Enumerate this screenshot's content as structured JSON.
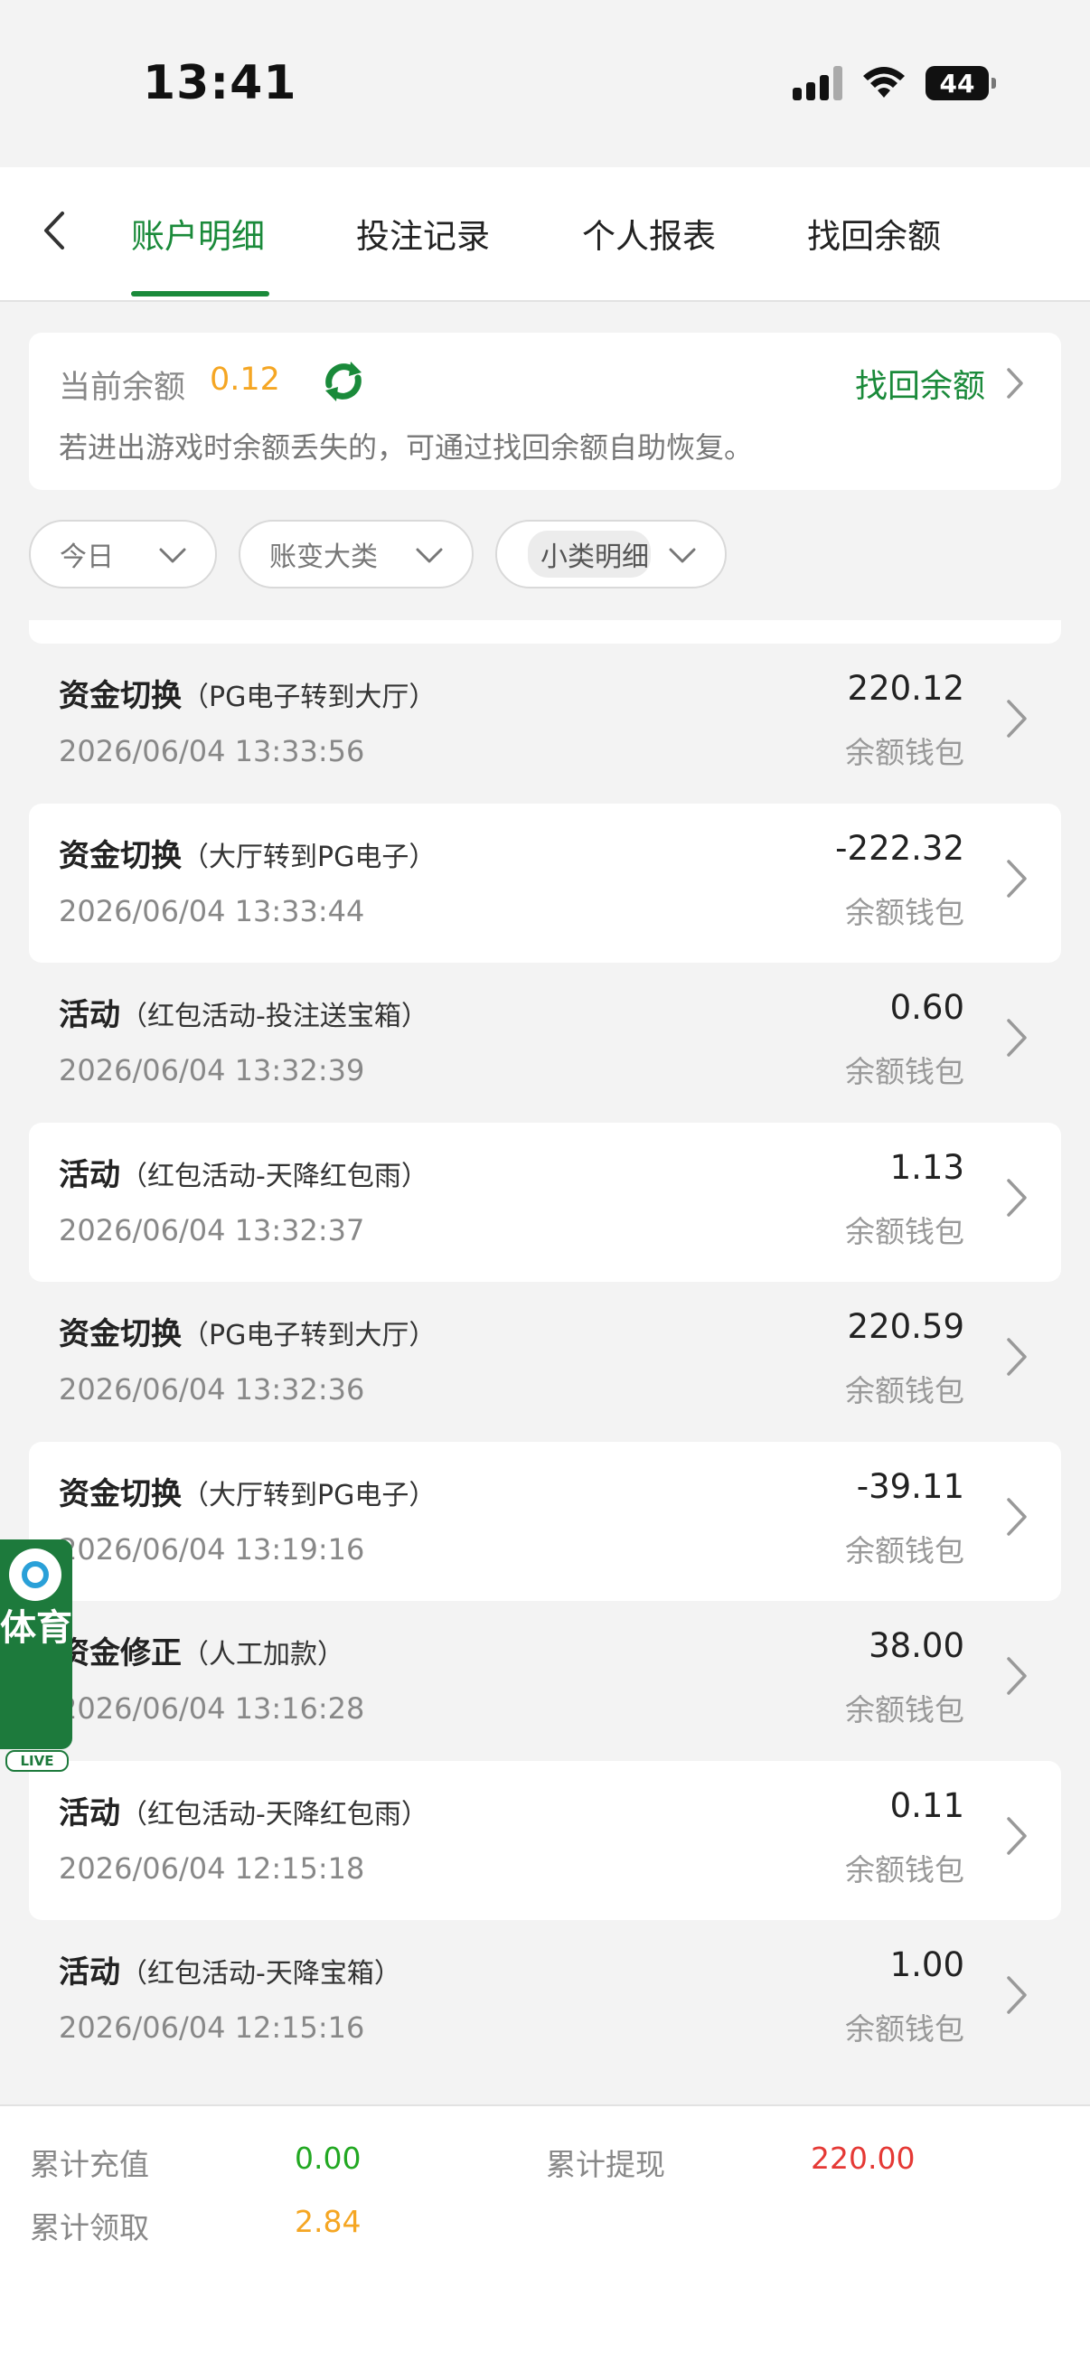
{
  "status_bar": {
    "time": "13:41",
    "battery": "44"
  },
  "tabs": [
    {
      "label": "账户明细",
      "active": true
    },
    {
      "label": "投注记录",
      "active": false
    },
    {
      "label": "个人报表",
      "active": false
    },
    {
      "label": "找回余额",
      "active": false
    }
  ],
  "balance": {
    "label": "当前余额",
    "value": "0.12",
    "recover_link": "找回余额",
    "tip": "若进出游戏时余额丢失的，可通过找回余额自助恢复。"
  },
  "filters": {
    "date": "今日",
    "category": "账变大类",
    "subcategory": "小类明细"
  },
  "transactions": [
    {
      "type": "资金切换",
      "detail": "（PG电子转到大厅）",
      "date": "2026/06/04 13:33:56",
      "amount": "220.12",
      "wallet": "余额钱包"
    },
    {
      "type": "资金切换",
      "detail": "（大厅转到PG电子）",
      "date": "2026/06/04 13:33:44",
      "amount": "-222.32",
      "wallet": "余额钱包"
    },
    {
      "type": "活动",
      "detail": "（红包活动-投注送宝箱）",
      "date": "2026/06/04 13:32:39",
      "amount": "0.60",
      "wallet": "余额钱包"
    },
    {
      "type": "活动",
      "detail": "（红包活动-天降红包雨）",
      "date": "2026/06/04 13:32:37",
      "amount": "1.13",
      "wallet": "余额钱包"
    },
    {
      "type": "资金切换",
      "detail": "（PG电子转到大厅）",
      "date": "2026/06/04 13:32:36",
      "amount": "220.59",
      "wallet": "余额钱包"
    },
    {
      "type": "资金切换",
      "detail": "（大厅转到PG电子）",
      "date": "2026/06/04 13:19:16",
      "amount": "-39.11",
      "wallet": "余额钱包"
    },
    {
      "type": "资金修正",
      "detail": "（人工加款）",
      "date": "2026/06/04 13:16:28",
      "amount": "38.00",
      "wallet": "余额钱包"
    },
    {
      "type": "活动",
      "detail": "（红包活动-天降红包雨）",
      "date": "2026/06/04 12:15:18",
      "amount": "0.11",
      "wallet": "余额钱包"
    },
    {
      "type": "活动",
      "detail": "（红包活动-天降宝箱）",
      "date": "2026/06/04 12:15:16",
      "amount": "1.00",
      "wallet": "余额钱包"
    }
  ],
  "sports_badge": {
    "text": "体育",
    "live": "LIVE"
  },
  "summary": {
    "deposit_label": "累计充值",
    "deposit_value": "0.00",
    "withdraw_label": "累计提现",
    "withdraw_value": "220.00",
    "claim_label": "累计领取",
    "claim_value": "2.84"
  },
  "colors": {
    "accent_green": "#1a8a3a",
    "balance_orange": "#f5a623",
    "deposit_green": "#22a822",
    "withdraw_red": "#e53935",
    "claim_orange": "#f5a623"
  }
}
